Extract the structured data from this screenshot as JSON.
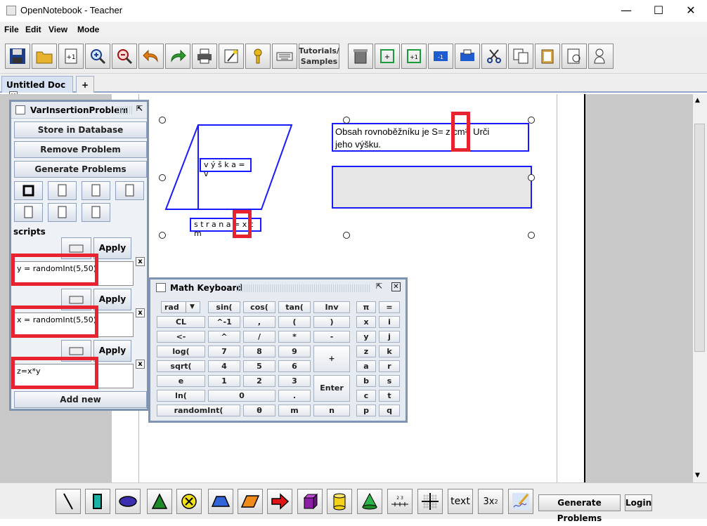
{
  "window": {
    "title": "OpenNotebook - Teacher",
    "min": "—",
    "max": "☐",
    "close": "✕"
  },
  "menu": {
    "file": "File",
    "edit": "Edit",
    "view": "View",
    "mode": "Mode"
  },
  "toolbar": {
    "tutorials_line1": "Tutorials/",
    "tutorials_line2": "Samples"
  },
  "tabs": {
    "doc_label": "Untitled Doc",
    "close": "x",
    "add": "+"
  },
  "panel": {
    "title": "VarInsertionProblem",
    "store": "Store in Database",
    "remove": "Remove Problem",
    "generate": "Generate Problems",
    "scripts_label": "scripts",
    "apply": "Apply",
    "remove_x": "x",
    "scripts": [
      "y = randomInt(5,50)",
      "x =  randomInt(5,50)",
      "z=x*y"
    ],
    "add_new": "Add new"
  },
  "canvas": {
    "height_label": "v ý š k a = v",
    "side_label": "s t r a n a = x c m",
    "text_line1": "Obsah rovnoběžníku je S=  z   cm². Urči",
    "text_line2": "jeho výšku."
  },
  "math_keyboard": {
    "title": "Math Keyboard",
    "mode": "rad",
    "keys": {
      "sin": "sin(",
      "cos": "cos(",
      "tan": "tan(",
      "inv": "Inv",
      "pi": "π",
      "eq": "=",
      "cl": "CL",
      "pow_neg": "^-1",
      "comma": ",",
      "lparen": "(",
      "rparen": ")",
      "x": "x",
      "i": "i",
      "back": "<-",
      "caret": "^",
      "slash": "/",
      "star": "*",
      "minus": "-",
      "y": "y",
      "j": "j",
      "log": "log(",
      "n7": "7",
      "n8": "8",
      "n9": "9",
      "plus": "+",
      "z": "z",
      "k": "k",
      "sqrt": "sqrt(",
      "n4": "4",
      "n5": "5",
      "n6": "6",
      "a": "a",
      "r": "r",
      "e": "e",
      "n1": "1",
      "n2": "2",
      "n3": "3",
      "enter": "Enter",
      "b": "b",
      "s": "s",
      "ln": "ln(",
      "n0": "0",
      "dot": ".",
      "c": "c",
      "t": "t",
      "randint": "randomInt(",
      "theta": "θ",
      "m": "m",
      "n": "n",
      "p": "p",
      "q": "q"
    }
  },
  "bottom": {
    "text_tool": "text",
    "expr_tool": "3x",
    "expr_sup": "2",
    "generate": "Generate Problems",
    "login": "Login"
  },
  "colors": {
    "accent_red": "#e8232f",
    "shape_blue": "#1a1aff",
    "panel_border": "#7f93b2"
  }
}
